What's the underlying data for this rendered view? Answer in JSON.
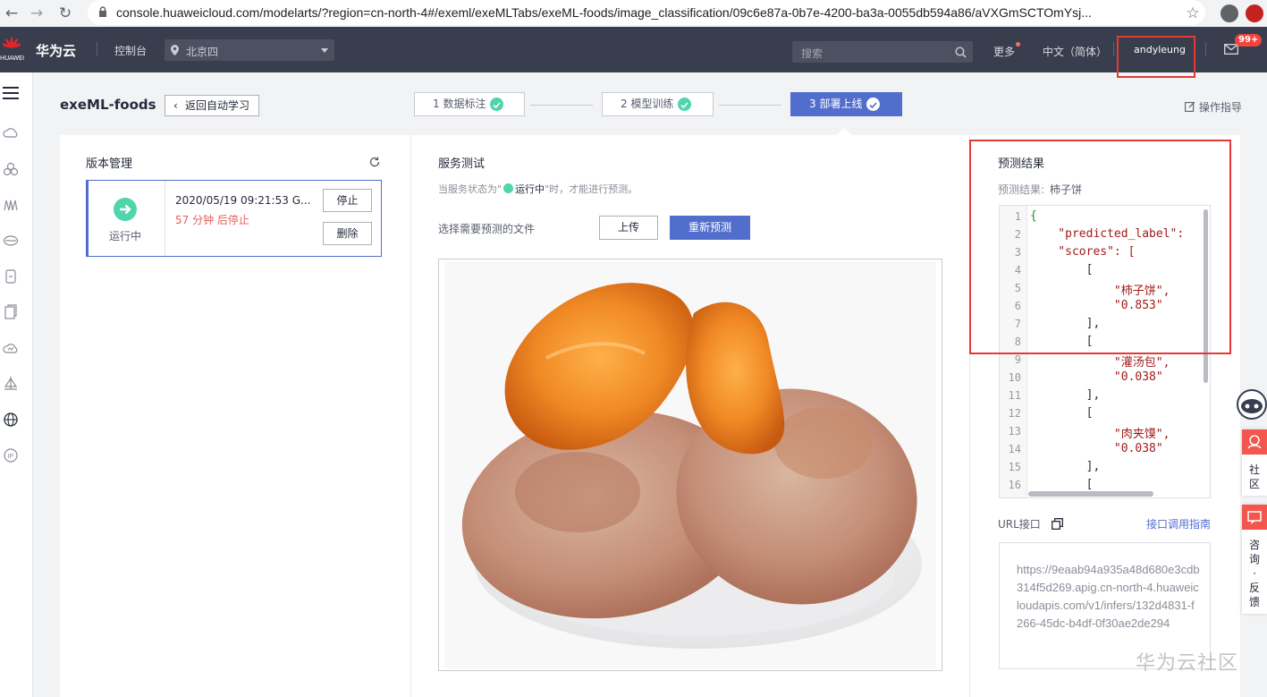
{
  "browser": {
    "url": "console.huaweicloud.com/modelarts/?region=cn-north-4#/exeml/exeMLTabs/exeML-foods/image_classification/09c6e87a-0b7e-4200-ba3a-0055db594a86/aVXGmSCTOmYsj..."
  },
  "topnav": {
    "logo_text": "HUAWEI",
    "brand": "华为云",
    "console": "控制台",
    "region": "北京四",
    "search_placeholder": "搜索",
    "more": "更多",
    "language": "中文（简体）",
    "username": "andyleung",
    "mail_badge": "99+"
  },
  "page": {
    "title": "exeML-foods",
    "back_button": "返回自动学习",
    "steps": [
      "1 数据标注",
      "2 模型训练",
      "3 部署上线"
    ],
    "guide": "操作指导"
  },
  "version_panel": {
    "title": "版本管理",
    "status": "运行中",
    "time": "2020/05/19 09:21:53 G...",
    "stop_hint": "57 分钟 后停止",
    "stop_button": "停止",
    "delete_button": "删除"
  },
  "service_test": {
    "title": "服务测试",
    "hint_pre": "当服务状态为\"",
    "hint_status": "运行中",
    "hint_post": "\"时，才能进行预测。",
    "file_label": "选择需要预测的文件",
    "upload_button": "上传",
    "repredict_button": "重新预测"
  },
  "result_panel": {
    "title": "预测结果",
    "result_label": "预测结果:",
    "result_value": "柿子饼",
    "code_lines": [
      "{",
      "    \"predicted_label\":",
      "    \"scores\": [",
      "        [",
      "            \"柿子饼\",",
      "            \"0.853\"",
      "        ],",
      "        [",
      "            \"灌汤包\",",
      "            \"0.038\"",
      "        ],",
      "        [",
      "            \"肉夹馍\",",
      "            \"0.038\"",
      "        ],",
      "        ["
    ],
    "url_label": "URL接口",
    "api_guide": "接口调用指南",
    "url_value": "https://9eaab94a935a48d680e3cdb314f5d269.apig.cn-north-4.huaweicloudapis.com/v1/infers/132d4831-f266-45dc-b4df-0f30ae2de294"
  },
  "float_bar": {
    "community": "社区",
    "feedback": "咨询·反馈"
  },
  "watermark": "华为云社区",
  "colors": {
    "topnav_bg": "#383e4e",
    "primary": "#526ecc",
    "success": "#50d4ab",
    "highlight_border": "#e53935",
    "warning_text": "#e5615c"
  }
}
